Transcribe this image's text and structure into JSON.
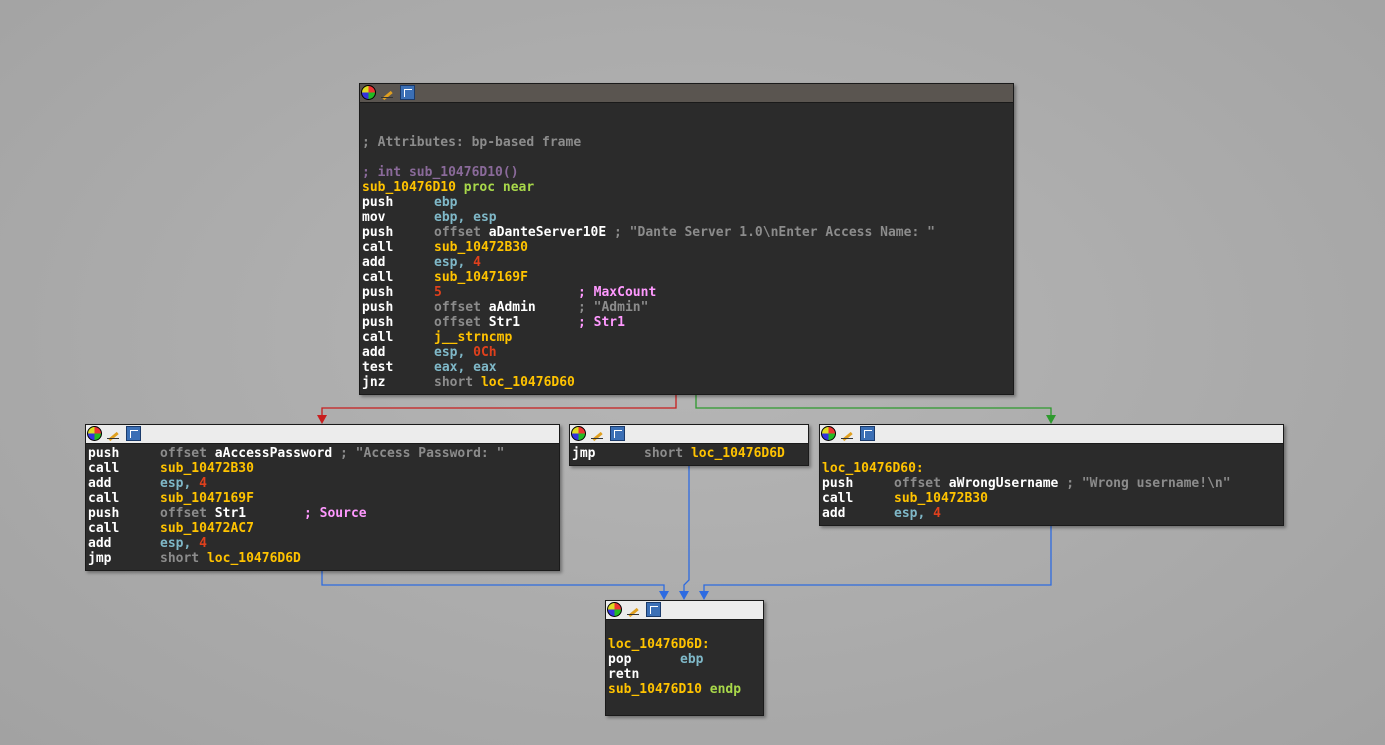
{
  "colors": {
    "edge_false": "#c81e1e",
    "edge_true": "#2e9a2e",
    "edge_flow": "#2e6be0"
  },
  "icons": {
    "color": "node-color-icon",
    "rename": "rename-icon",
    "graph": "graph-overview-icon"
  },
  "block_main": {
    "attr_comment": "; Attributes: bp-based frame",
    "signature": "; int sub_10476D10()",
    "proc_name": "sub_10476D10",
    "proc_kw": "proc near",
    "l1_mn": "push",
    "l1_op": "ebp",
    "l2_mn": "mov",
    "l2_op": "ebp, esp",
    "l3_mn": "push",
    "l3_kw": "offset",
    "l3_sym": "aDanteServer10E",
    "l3_cmt": "; \"Dante Server 1.0\\nEnter Access Name: \"",
    "l4_mn": "call",
    "l4_sym": "sub_10472B30",
    "l5_mn": "add",
    "l5_reg": "esp,",
    "l5_num": "4",
    "l6_mn": "call",
    "l6_sym": "sub_1047169F",
    "l7_mn": "push",
    "l7_num": "5",
    "l7_cmt": "; MaxCount",
    "l8_mn": "push",
    "l8_kw": "offset",
    "l8_sym": "aAdmin",
    "l8_cmt": "; \"Admin\"",
    "l9_mn": "push",
    "l9_kw": "offset",
    "l9_sym": "Str1",
    "l9_cmt": "; Str1",
    "l10_mn": "call",
    "l10_sym": "j__strncmp",
    "l11_mn": "add",
    "l11_reg": "esp,",
    "l11_num": "0Ch",
    "l12_mn": "test",
    "l12_op": "eax, eax",
    "l13_mn": "jnz",
    "l13_kw": "short",
    "l13_sym": "loc_10476D60"
  },
  "block_left": {
    "l1_mn": "push",
    "l1_kw": "offset",
    "l1_sym": "aAccessPassword",
    "l1_cmt": "; \"Access Password: \"",
    "l2_mn": "call",
    "l2_sym": "sub_10472B30",
    "l3_mn": "add",
    "l3_reg": "esp,",
    "l3_num": "4",
    "l4_mn": "call",
    "l4_sym": "sub_1047169F",
    "l5_mn": "push",
    "l5_kw": "offset",
    "l5_sym": "Str1",
    "l5_cmt": "; Source",
    "l6_mn": "call",
    "l6_sym": "sub_10472AC7",
    "l7_mn": "add",
    "l7_reg": "esp,",
    "l7_num": "4",
    "l8_mn": "jmp",
    "l8_kw": "short",
    "l8_sym": "loc_10476D6D"
  },
  "block_mid": {
    "l1_mn": "jmp",
    "l1_kw": "short",
    "l1_sym": "loc_10476D6D"
  },
  "block_right": {
    "label": "loc_10476D60:",
    "l1_mn": "push",
    "l1_kw": "offset",
    "l1_sym": "aWrongUsername",
    "l1_cmt": "; \"Wrong username!\\n\"",
    "l2_mn": "call",
    "l2_sym": "sub_10472B30",
    "l3_mn": "add",
    "l3_reg": "esp,",
    "l3_num": "4"
  },
  "block_bottom": {
    "label": "loc_10476D6D:",
    "l1_mn": "pop",
    "l1_op": "ebp",
    "l2_mn": "retn",
    "l3_name": "sub_10476D10",
    "l3_kw": "endp"
  }
}
